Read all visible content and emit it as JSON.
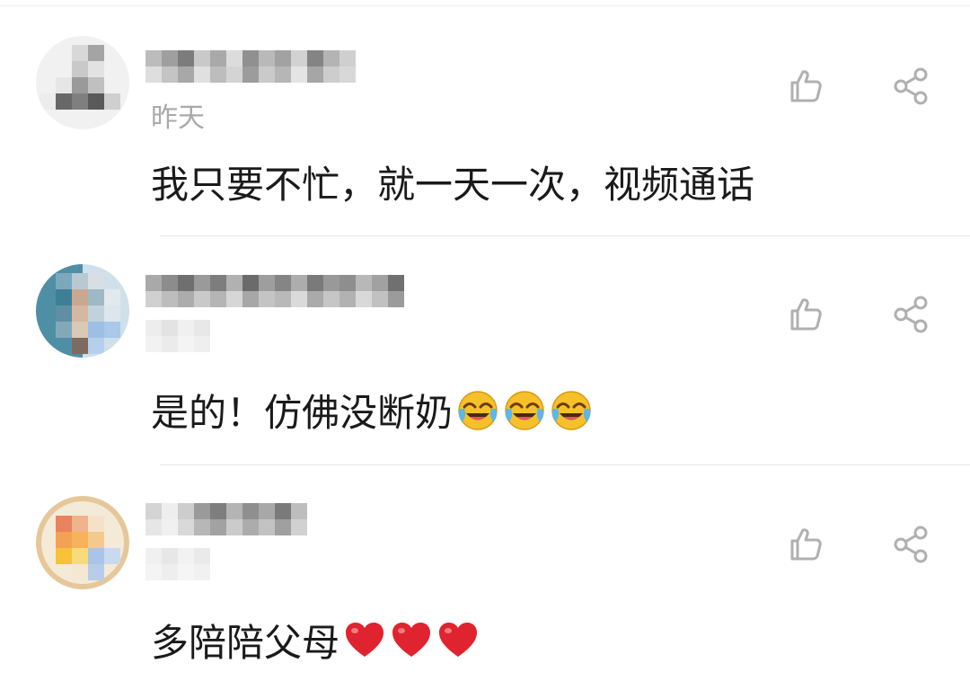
{
  "comments": [
    {
      "time": "昨天",
      "text": "我只要不忙，就一天一次，视频通话",
      "emoji": []
    },
    {
      "time": "",
      "text": "是的！仿佛没断奶",
      "emoji": [
        "laugh-cry",
        "laugh-cry",
        "laugh-cry"
      ]
    },
    {
      "time": "",
      "text": "多陪陪父母",
      "emoji": [
        "red-heart",
        "red-heart",
        "red-heart"
      ]
    }
  ],
  "icons": {
    "like": "thumbs-up-icon",
    "share": "share-icon"
  },
  "colors": {
    "text": "#1a1a1a",
    "meta": "#a9a9a9",
    "icon": "#b0b0b0",
    "divider": "#e6e6e6",
    "heart": "#e0242f",
    "emoji_face": "#f6c02b"
  }
}
